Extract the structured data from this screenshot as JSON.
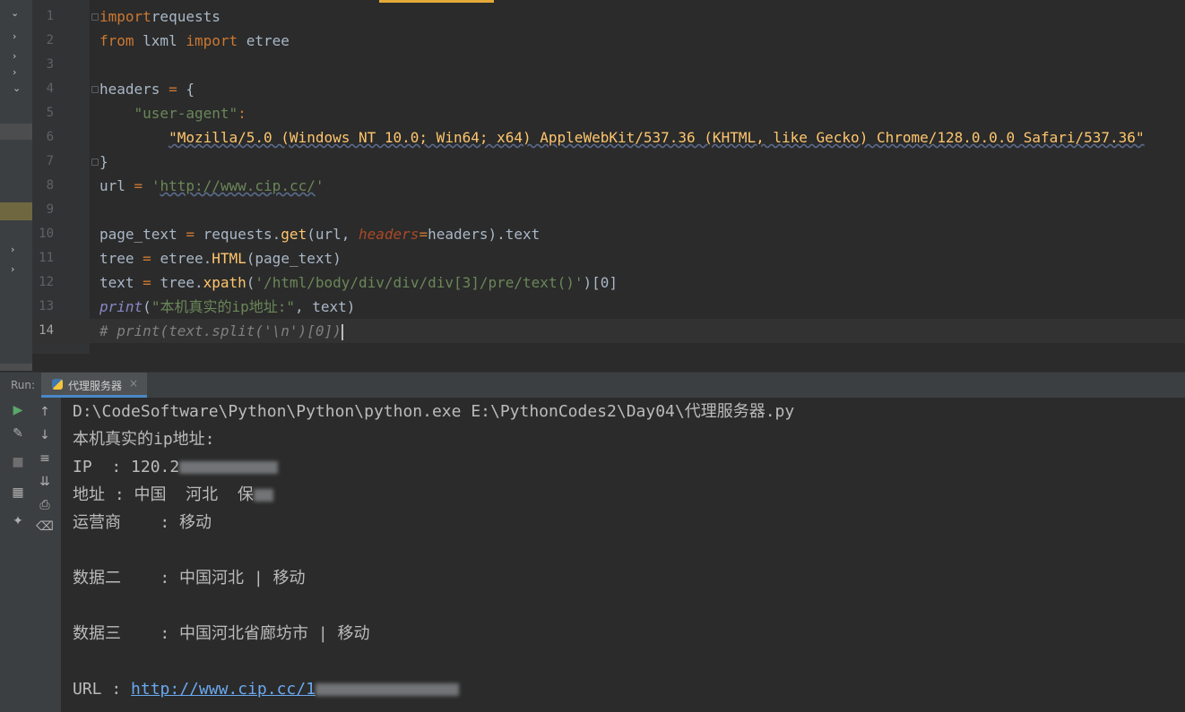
{
  "editor": {
    "lines": [
      {
        "num": "1",
        "tokens": [
          [
            "kw",
            "import"
          ],
          [
            "",
            "requests"
          ]
        ]
      },
      {
        "num": "2",
        "tokens": [
          [
            "kw",
            "from"
          ],
          [
            "",
            " lxml "
          ],
          [
            "kw",
            "import"
          ],
          [
            "",
            " etree"
          ]
        ]
      },
      {
        "num": "3",
        "tokens": []
      },
      {
        "num": "4",
        "tokens": [
          [
            "",
            "headers "
          ],
          [
            "kw",
            "="
          ],
          [
            "",
            " {"
          ]
        ]
      },
      {
        "num": "5",
        "tokens": [
          [
            "",
            "    "
          ],
          [
            "str",
            "\"user-agent\""
          ],
          [
            "kw",
            ":"
          ]
        ]
      },
      {
        "num": "6",
        "tokens": [
          [
            "",
            "        "
          ],
          [
            "strw",
            "\"Mozilla/5.0 (Windows NT 10.0; Win64; x64) AppleWebKit/537.36 (KHTML, like Gecko) Chrome/128.0.0.0 Safari/537.36\""
          ]
        ]
      },
      {
        "num": "7",
        "tokens": [
          [
            "",
            "}"
          ]
        ]
      },
      {
        "num": "8",
        "tokens": [
          [
            "",
            "url "
          ],
          [
            "kw",
            "="
          ],
          [
            "",
            " "
          ],
          [
            "str",
            "'"
          ],
          [
            "url",
            "http://www.cip.cc/"
          ],
          [
            "str",
            "'"
          ]
        ]
      },
      {
        "num": "9",
        "tokens": []
      },
      {
        "num": "10",
        "tokens": [
          [
            "",
            "page_text "
          ],
          [
            "kw",
            "="
          ],
          [
            "",
            " requests."
          ],
          [
            "fn",
            "get"
          ],
          [
            "",
            "(url, "
          ],
          [
            "param",
            "headers"
          ],
          [
            "kw",
            "="
          ],
          [
            "",
            "headers)."
          ],
          [
            "",
            "text"
          ]
        ]
      },
      {
        "num": "11",
        "tokens": [
          [
            "",
            "tree "
          ],
          [
            "kw",
            "="
          ],
          [
            "",
            " etree."
          ],
          [
            "fn",
            "HTML"
          ],
          [
            "",
            "(page_text)"
          ]
        ]
      },
      {
        "num": "12",
        "tokens": [
          [
            "",
            "text "
          ],
          [
            "kw",
            "="
          ],
          [
            "",
            " tree."
          ],
          [
            "fn",
            "xpath"
          ],
          [
            "",
            "("
          ],
          [
            "str",
            "'/html/body/div/div/div[3]/pre/text()'"
          ],
          [
            "",
            ")[0]"
          ]
        ]
      },
      {
        "num": "13",
        "tokens": [
          [
            "builtin",
            "print"
          ],
          [
            "",
            "("
          ],
          [
            "str",
            "\"本机真实的ip地址:\""
          ],
          [
            "",
            ", text)"
          ]
        ]
      },
      {
        "num": "14",
        "tokens": [
          [
            "cm",
            "# print(text.split('\\n')[0])"
          ]
        ]
      }
    ]
  },
  "run": {
    "label": "Run:",
    "tab_title": "代理服务器",
    "tab_close": "×",
    "console": [
      "D:\\CodeSoftware\\Python\\Python\\python.exe E:\\PythonCodes2\\Day04\\代理服务器.py",
      "本机真实的ip地址:",
      "IP  : 120.2",
      "地址 : 中国  河北  保",
      "运营商    : 移动",
      "",
      "数据二    : 中国河北 | 移动",
      "",
      "数据三    : 中国河北省廊坊市 | 移动",
      "",
      "URL : "
    ],
    "url_prefix": "http://www.cip.cc/1"
  },
  "icons": [
    "run-icon",
    "up-arrow-icon",
    "wrench-icon",
    "down-arrow-icon",
    "stop-icon",
    "soft-wrap-icon",
    "layout-icon",
    "scroll-to-end-icon",
    "print-icon",
    "pin-icon",
    "trash-icon"
  ]
}
